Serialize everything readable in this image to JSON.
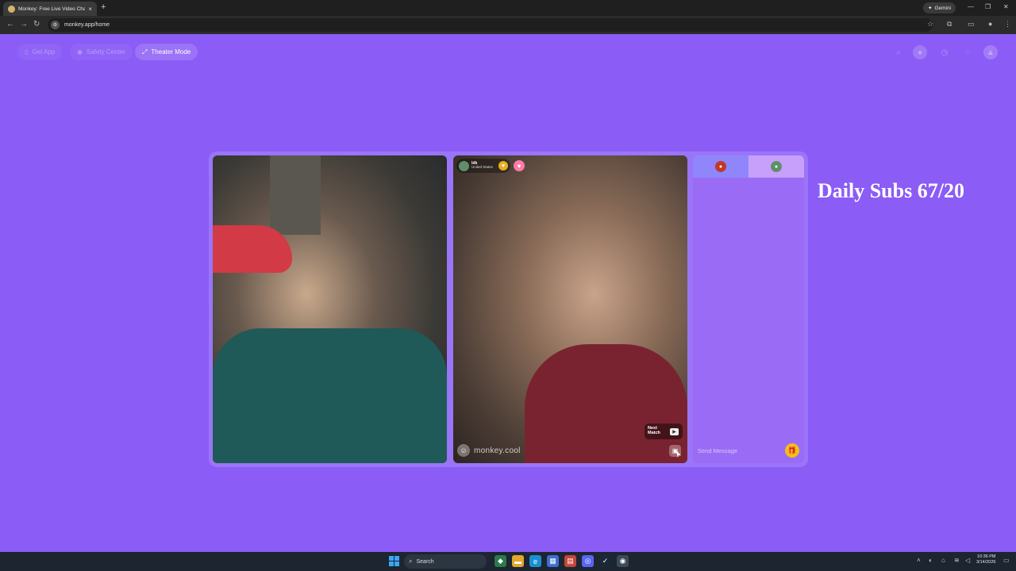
{
  "browser": {
    "tab_title": "Monkey: Free Live Video Chat",
    "tab_close": "×",
    "new_tab": "+",
    "gemini_label": "Gemini",
    "url": "monkey.app/home",
    "window_controls": [
      "—",
      "❐",
      "✕"
    ]
  },
  "site": {
    "nav": {
      "get_app": "Get App",
      "safety_center": "Safety Center",
      "theater_mode": "Theater Mode"
    },
    "header_icons": [
      "search-icon",
      "avatar-icon",
      "history-icon",
      "chat-icon",
      "profile-icon"
    ]
  },
  "call": {
    "remote_user": {
      "name": "ldk",
      "country": "United States"
    },
    "next_match_label": "Next Match",
    "next_match_key": "▶",
    "watermark": "monkey.cool"
  },
  "chat": {
    "placeholder": "Send Message"
  },
  "overlay": {
    "text": "Daily Subs 67/20"
  },
  "taskbar": {
    "search_label": "Search",
    "time": "10:36 PM",
    "date": "3/14/2026"
  },
  "colors": {
    "page_bg": "#8b5cf6",
    "chat_bg": "#9a6cf5",
    "gift": "#f2c011"
  }
}
